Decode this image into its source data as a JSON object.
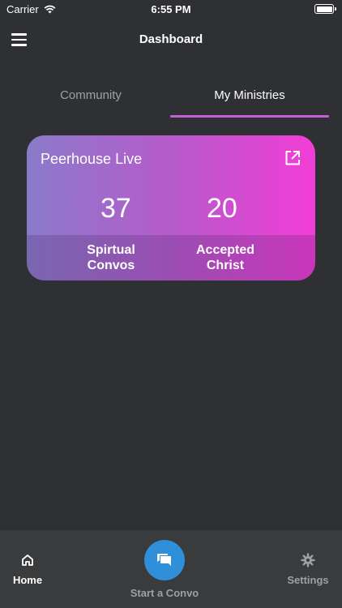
{
  "status_bar": {
    "carrier": "Carrier",
    "time": "6:55 PM"
  },
  "header": {
    "title": "Dashboard"
  },
  "tabs": [
    {
      "label": "Community",
      "active": false
    },
    {
      "label": "My Ministries",
      "active": true
    }
  ],
  "card": {
    "title": "Peerhouse Live",
    "stats": [
      {
        "value": "37",
        "label_line1": "Spirtual",
        "label_line2": "Convos"
      },
      {
        "value": "20",
        "label_line1": "Accepted",
        "label_line2": "Christ"
      }
    ]
  },
  "bottom_nav": {
    "home_label": "Home",
    "start_label": "Start a Convo",
    "settings_label": "Settings"
  },
  "colors": {
    "background": "#2e3034",
    "tab_indicator": "#c55ed6",
    "card_gradient_start": "#8a7bc9",
    "card_gradient_end": "#f23dd6",
    "fab": "#2f8fd9",
    "nav_background": "#3a3b3c"
  },
  "icons": {
    "wifi": "wifi-icon",
    "battery": "battery-icon",
    "menu": "hamburger-menu-icon",
    "open_external": "open-external-icon",
    "home": "home-icon",
    "chat": "chat-bubbles-icon",
    "settings": "gear-icon"
  }
}
